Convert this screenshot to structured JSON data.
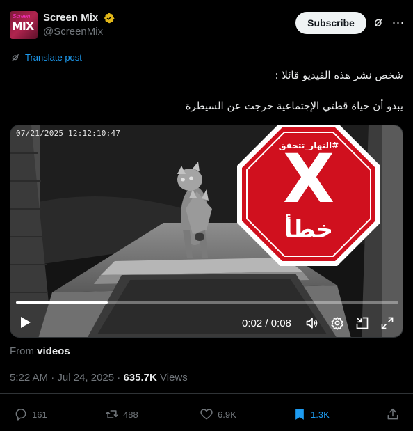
{
  "author": {
    "display_name": "Screen Mix",
    "handle": "@ScreenMix",
    "avatar_text": "MIX",
    "avatar_small_text": "Screen"
  },
  "header": {
    "subscribe_label": "Subscribe"
  },
  "translate": {
    "label": "Translate post"
  },
  "post": {
    "line1": "شخص نشر هذه الفيديو قائلا :",
    "line2": "يبدو أن حياة قطتي الإجتماعية خرجت عن السيطرة"
  },
  "video": {
    "camera_timestamp": "07/21/2025  12:12:10:47",
    "time_readout": "0:02 / 0:08",
    "progress_fraction": 0.24,
    "stamp": {
      "hashtag": "#النهار_تتحقق",
      "mark": "X",
      "word": "خطأ"
    }
  },
  "source": {
    "prefix": "From",
    "name": "videos"
  },
  "meta": {
    "time": "5:22 AM",
    "separator": "·",
    "date": "Jul 24, 2025",
    "views_count": "635.7K",
    "views_label": "Views"
  },
  "actions": {
    "replies": "161",
    "reposts": "488",
    "likes": "6.9K",
    "bookmarks": "1.3K"
  },
  "colors": {
    "background": "#000000",
    "accent": "#1d9bf0",
    "muted": "#71767b",
    "stamp_red": "#d0101e",
    "verified_gold": "#e2b719"
  }
}
